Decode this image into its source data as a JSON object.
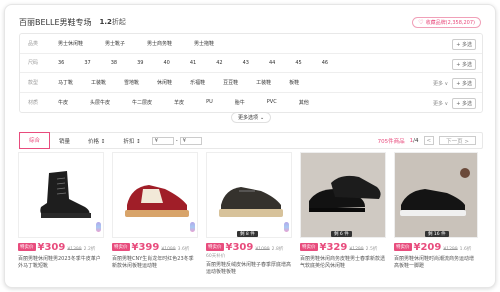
{
  "header": {
    "store_name": "百丽BELLE男鞋专场",
    "count_num": "1.2",
    "count_unit": "折起",
    "fav_icon": "heart-icon",
    "fav_label": "收藏品牌(2,358,207)"
  },
  "filters": {
    "rows": [
      {
        "label": "品类",
        "options": [
          "男士休闲鞋",
          "男士靴子",
          "男士商务鞋",
          "男士拖鞋"
        ],
        "more": "",
        "multi": "+ 多选"
      },
      {
        "label": "尺码",
        "options": [
          "36",
          "37",
          "38",
          "39",
          "40",
          "41",
          "42",
          "43",
          "44",
          "45",
          "46"
        ],
        "more": "",
        "multi": "+ 多选"
      },
      {
        "label": "款型",
        "options": [
          "马丁靴",
          "工装靴",
          "雪地靴",
          "休闲鞋",
          "乐福鞋",
          "豆豆鞋",
          "工装鞋",
          "板鞋"
        ],
        "more": "更多 ∨",
        "multi": "+ 多选"
      },
      {
        "label": "材质",
        "options": [
          "牛皮",
          "头层牛皮",
          "牛二层皮",
          "羊皮",
          "PU",
          "胎牛",
          "PVC",
          "其他"
        ],
        "more": "更多 ∨",
        "multi": "+ 多选"
      }
    ],
    "more_options": "更多选项"
  },
  "sortbar": {
    "items": [
      "综合",
      "销量",
      "价格 ↕",
      "折扣 ↕"
    ],
    "price_from": "¥",
    "price_sep": "-",
    "price_to": "¥",
    "result_count": "705件商品",
    "page_current": "1",
    "page_total": "/4",
    "prev": "<",
    "next": "下一页 >"
  },
  "products": [
    {
      "price": "¥309",
      "orig": "¥1399",
      "disc": "2.2折",
      "tag": "特卖价",
      "sold": "",
      "badge": "",
      "name": "百丽男鞋休闲鞋男2023冬季牛皮革户外马丁靴短靴"
    },
    {
      "price": "¥399",
      "orig": "¥1099",
      "disc": "3.6折",
      "tag": "特卖价",
      "sold": "",
      "badge": "",
      "name": "百丽男鞋CNY生肖龙年时红色23冬季新款休闲板鞋运动鞋"
    },
    {
      "price": "¥309",
      "orig": "¥1099",
      "disc": "2.8折",
      "tag": "特卖价",
      "sold": "60天补价",
      "badge": "剩 8 件",
      "name": "百丽男鞋反绒皮休闲鞋子春季厚底增高运动板鞋板鞋"
    },
    {
      "price": "¥329",
      "orig": "¥1299",
      "disc": "2.5折",
      "tag": "特卖价",
      "sold": "",
      "badge": "剩 6 件",
      "name": "百丽男鞋休闲商务皮鞋男士春季新款透气软底英伦风休闲鞋"
    },
    {
      "price": "¥209",
      "orig": "¥1299",
      "disc": "1.6折",
      "tag": "特卖价",
      "sold": "",
      "badge": "剩 16 件",
      "name": "百丽男鞋休闲鞋时尚潮流商务运动增高板鞋一脚蹬"
    }
  ]
}
